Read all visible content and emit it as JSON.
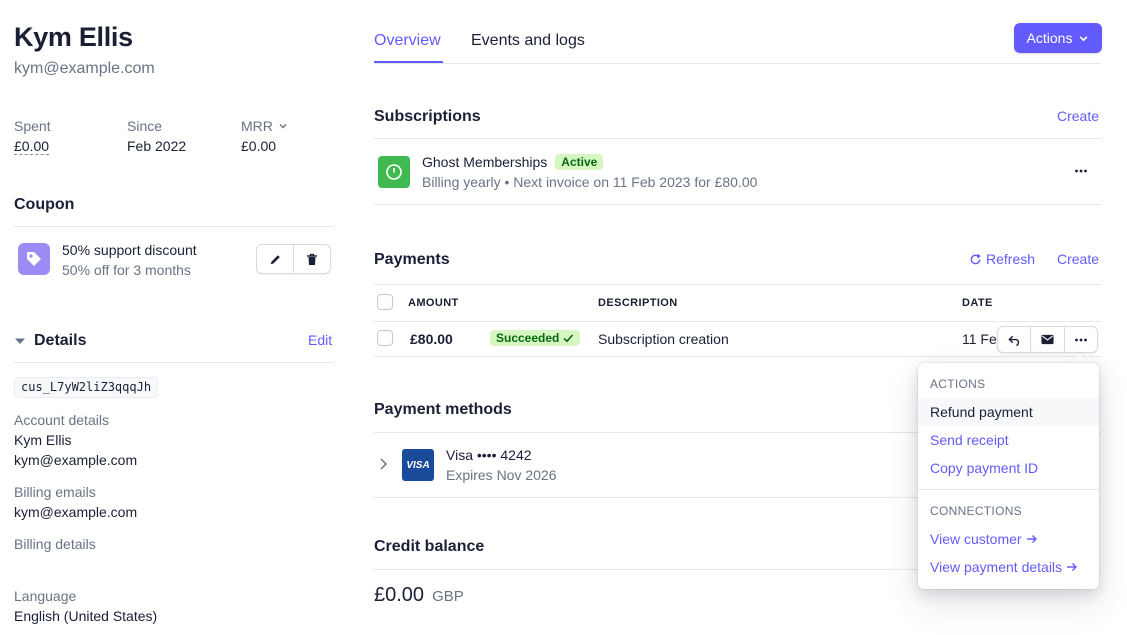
{
  "customer": {
    "name": "Kym Ellis",
    "email": "kym@example.com",
    "stats": [
      {
        "label": "Spent",
        "value": "£0.00"
      },
      {
        "label": "Since",
        "value": "Feb 2022"
      },
      {
        "label": "MRR",
        "value": "£0.00"
      }
    ]
  },
  "coupon": {
    "heading": "Coupon",
    "name": "50% support discount",
    "detail": "50% off for 3 months"
  },
  "details": {
    "heading": "Details",
    "edit_label": "Edit",
    "customer_id": "cus_L7yW2liZ3qqqJh",
    "account_label": "Account details",
    "account_name": "Kym Ellis",
    "account_email": "kym@example.com",
    "billing_emails_label": "Billing emails",
    "billing_email": "kym@example.com",
    "billing_details_label": "Billing details",
    "language_label": "Language",
    "language": "English (United States)"
  },
  "tabs": [
    {
      "label": "Overview",
      "active": true
    },
    {
      "label": "Events and logs",
      "active": false
    }
  ],
  "actions_label": "Actions",
  "subscriptions": {
    "heading": "Subscriptions",
    "create_label": "Create",
    "item": {
      "name": "Ghost Memberships",
      "status": "Active",
      "detail": "Billing yearly • Next invoice on 11 Feb 2023 for £80.00"
    }
  },
  "payments": {
    "heading": "Payments",
    "refresh_label": "Refresh",
    "create_label": "Create",
    "columns": [
      "AMOUNT",
      "DESCRIPTION",
      "DATE"
    ],
    "rows": [
      {
        "amount": "£80.00",
        "status": "Succeeded",
        "description": "Subscription creation",
        "date": "11 Feb"
      }
    ]
  },
  "payment_methods": {
    "heading": "Payment methods",
    "card_brand": "VISA",
    "card_label": "Visa •••• 4242",
    "expiry": "Expires Nov 2026"
  },
  "credit_balance": {
    "heading": "Credit balance",
    "amount": "£0.00",
    "currency": "GBP"
  },
  "menu": {
    "actions_heading": "ACTIONS",
    "items": [
      "Refund payment",
      "Send receipt",
      "Copy payment ID"
    ],
    "connections_heading": "CONNECTIONS",
    "links": [
      "View customer",
      "View payment details"
    ]
  },
  "colors": {
    "accent": "#635bff",
    "success_bg": "#d7f7c2",
    "success_text": "#05690d",
    "subscription_icon": "#3fb950",
    "coupon_icon": "#9b8cf5"
  }
}
